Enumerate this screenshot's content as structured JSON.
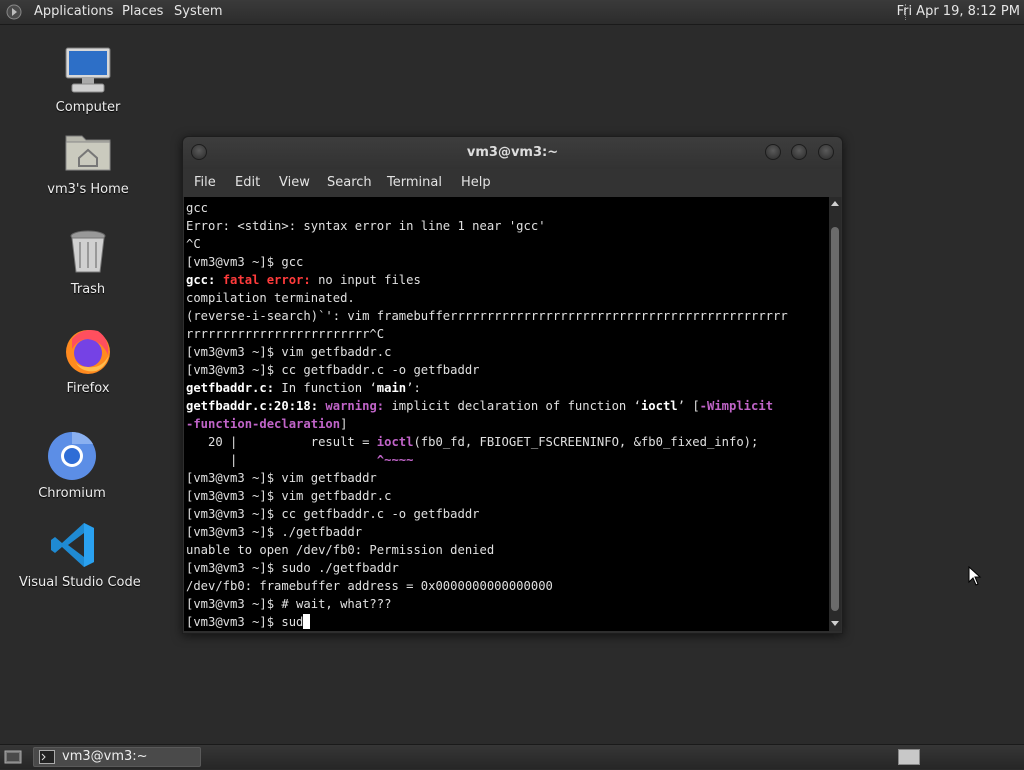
{
  "top_panel": {
    "menus": [
      "Applications",
      "Places",
      "System"
    ],
    "clock": "Fri Apr 19,  8:12 PM"
  },
  "desktop": {
    "icons": [
      {
        "label": "Computer",
        "icon": "computer-icon"
      },
      {
        "label": "vm3's Home",
        "icon": "home-folder-icon"
      },
      {
        "label": "Trash",
        "icon": "trash-icon"
      },
      {
        "label": "Firefox",
        "icon": "firefox-icon"
      },
      {
        "label": "Chromium",
        "icon": "chromium-icon"
      },
      {
        "label": "Visual Studio Code",
        "icon": "vscode-icon"
      }
    ]
  },
  "terminal": {
    "title": "vm3@vm3:~",
    "menu": [
      "File",
      "Edit",
      "View",
      "Search",
      "Terminal",
      "Help"
    ],
    "lines": [
      [
        {
          "t": "gcc"
        }
      ],
      [
        {
          "t": "Error: <stdin>: syntax error in line 1 near 'gcc'"
        }
      ],
      [
        {
          "t": "^C"
        }
      ],
      [
        {
          "t": "[vm3@vm3 ~]$ gcc"
        }
      ],
      [
        {
          "t": "gcc: ",
          "c": "b"
        },
        {
          "t": "fatal error: ",
          "c": "red"
        },
        {
          "t": "no input files"
        }
      ],
      [
        {
          "t": "compilation terminated."
        }
      ],
      [
        {
          "t": "(reverse-i-search)`': vim framebufferrrrrrrrrrrrrrrrrrrrrrrrrrrrrrrrrrrrrrrrrrrrrr"
        }
      ],
      [
        {
          "t": "rrrrrrrrrrrrrrrrrrrrrrrrr^C"
        }
      ],
      [
        {
          "t": "[vm3@vm3 ~]$ vim getfbaddr.c"
        }
      ],
      [
        {
          "t": "[vm3@vm3 ~]$ cc getfbaddr.c -o getfbaddr"
        }
      ],
      [
        {
          "t": "getfbaddr.c:",
          "c": "b"
        },
        {
          "t": " In function ‘"
        },
        {
          "t": "main",
          "c": "b"
        },
        {
          "t": "’:"
        }
      ],
      [
        {
          "t": "getfbaddr.c:20:18: ",
          "c": "b"
        },
        {
          "t": "warning: ",
          "c": "mag"
        },
        {
          "t": "implicit declaration of function ‘"
        },
        {
          "t": "ioctl",
          "c": "b"
        },
        {
          "t": "’ ["
        },
        {
          "t": "-Wimplicit",
          "c": "mag"
        }
      ],
      [
        {
          "t": "-function-declaration",
          "c": "mag"
        },
        {
          "t": "]"
        }
      ],
      [
        {
          "t": "   20 |          result = "
        },
        {
          "t": "ioctl",
          "c": "mag"
        },
        {
          "t": "(fb0_fd, FBIOGET_FSCREENINFO, &fb0_fixed_info);"
        }
      ],
      [
        {
          "t": "      |                   "
        },
        {
          "t": "^~~~~",
          "c": "mag"
        }
      ],
      [
        {
          "t": "[vm3@vm3 ~]$ vim getfbaddr"
        }
      ],
      [
        {
          "t": "[vm3@vm3 ~]$ vim getfbaddr.c"
        }
      ],
      [
        {
          "t": "[vm3@vm3 ~]$ cc getfbaddr.c -o getfbaddr"
        }
      ],
      [
        {
          "t": "[vm3@vm3 ~]$ ./getfbaddr"
        }
      ],
      [
        {
          "t": "unable to open /dev/fb0: Permission denied"
        }
      ],
      [
        {
          "t": "[vm3@vm3 ~]$ sudo ./getfbaddr"
        }
      ],
      [
        {
          "t": "/dev/fb0: framebuffer address = 0x0000000000000000"
        }
      ],
      [
        {
          "t": "[vm3@vm3 ~]$ # wait, what???"
        }
      ],
      [
        {
          "t": "[vm3@vm3 ~]$ sud"
        }
      ]
    ]
  },
  "taskbar": {
    "window_label": "vm3@vm3:~"
  }
}
